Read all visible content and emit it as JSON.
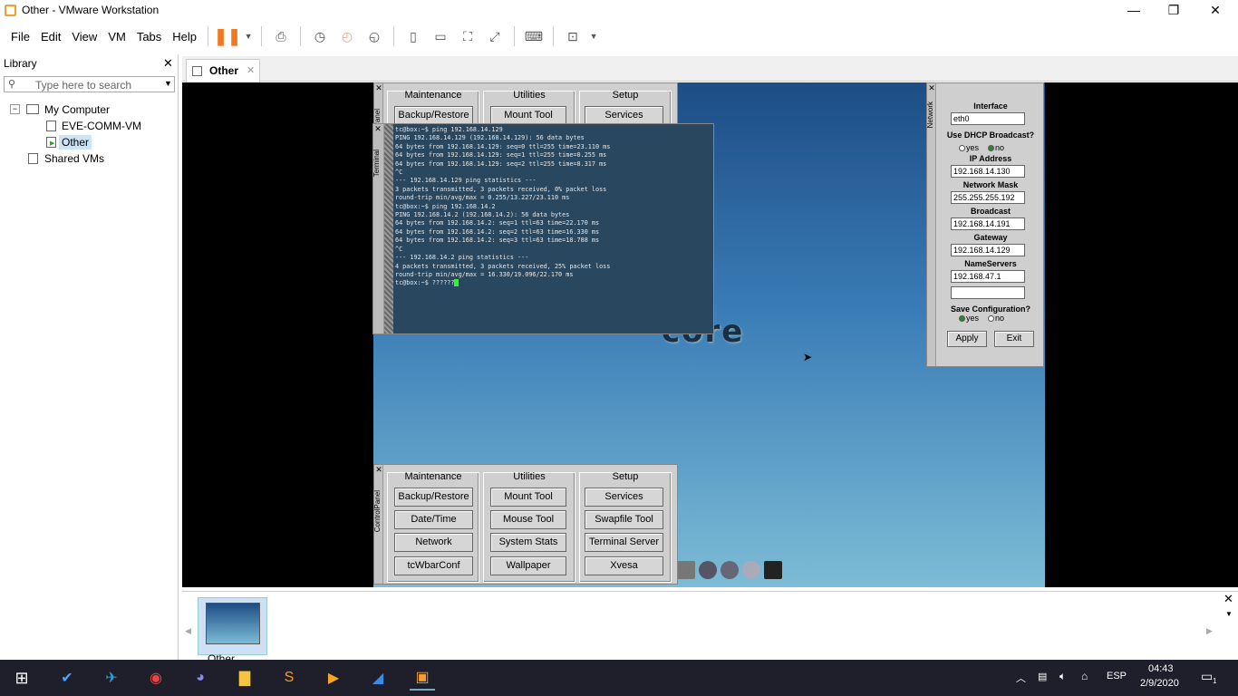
{
  "window": {
    "title": "Other - VMware Workstation",
    "minimize": "—",
    "restore": "❐",
    "close": "✕"
  },
  "menu": [
    "File",
    "Edit",
    "View",
    "VM",
    "Tabs",
    "Help"
  ],
  "library": {
    "title": "Library",
    "close": "✕",
    "search_placeholder": "Type here to search",
    "tree": {
      "root": "My Computer",
      "children": [
        "EVE-COMM-VM",
        "Other"
      ],
      "shared": "Shared VMs"
    }
  },
  "tab": {
    "label": "Other",
    "close": "✕"
  },
  "control_panel": {
    "side_label": "ControlPanel",
    "groups": [
      {
        "title": "Maintenance",
        "buttons": [
          "Backup/Restore",
          "Date/Time",
          "Network",
          "tcWbarConf"
        ]
      },
      {
        "title": "Utilities",
        "buttons": [
          "Mount Tool",
          "Mouse Tool",
          "System Stats",
          "Wallpaper"
        ]
      },
      {
        "title": "Setup",
        "buttons": [
          "Services",
          "Swapfile Tool",
          "Terminal Server",
          "Xvesa"
        ]
      }
    ]
  },
  "terminal": {
    "side_label": "Terminal",
    "lines": [
      "tc@box:~$ ping 192.168.14.129",
      "PING 192.168.14.129 (192.168.14.129): 56 data bytes",
      "64 bytes from 192.168.14.129: seq=0 ttl=255 time=23.110 ms",
      "64 bytes from 192.168.14.129: seq=1 ttl=255 time=0.255 ms",
      "64 bytes from 192.168.14.129: seq=2 ttl=255 time=8.317 ms",
      "^C",
      "--- 192.168.14.129 ping statistics ---",
      "3 packets transmitted, 3 packets received, 0% packet loss",
      "round-trip min/avg/max = 0.255/13.227/23.110 ms",
      "tc@box:~$ ping 192.168.14.2",
      "PING 192.168.14.2 (192.168.14.2): 56 data bytes",
      "64 bytes from 192.168.14.2: seq=1 ttl=63 time=22.170 ms",
      "64 bytes from 192.168.14.2: seq=2 ttl=63 time=16.330 ms",
      "64 bytes from 192.168.14.2: seq=3 ttl=63 time=18.788 ms",
      "^C",
      "--- 192.168.14.2 ping statistics ---",
      "4 packets transmitted, 3 packets received, 25% packet loss",
      "round-trip min/avg/max = 16.330/19.096/22.170 ms",
      "tc@box:~$ ??????"
    ]
  },
  "network": {
    "side_label": "Network",
    "interface_label": "Interface",
    "interface": "eth0",
    "dhcp_label": "Use DHCP Broadcast?",
    "dhcp_yes": "yes",
    "dhcp_no": "no",
    "ip_label": "IP Address",
    "ip": "192.168.14.130",
    "mask_label": "Network Mask",
    "mask": "255.255.255.192",
    "broadcast_label": "Broadcast",
    "broadcast": "192.168.14.191",
    "gateway_label": "Gateway",
    "gateway": "192.168.14.129",
    "ns_label": "NameServers",
    "ns1": "192.168.47.1",
    "ns2": "",
    "save_label": "Save Configuration?",
    "save_yes": "yes",
    "save_no": "no",
    "apply": "Apply",
    "exit": "Exit"
  },
  "desktop_logo": "core",
  "thumbnail": {
    "label": "Other"
  },
  "taskbar": {
    "lang": "ESP",
    "time": "04:43",
    "date": "2/9/2020",
    "notif": "1"
  },
  "colors": {
    "accent": "#f0a030",
    "desktop_top": "#1d4d85",
    "desktop_bottom": "#7cbcd6",
    "terminal_bg": "#29475f"
  }
}
